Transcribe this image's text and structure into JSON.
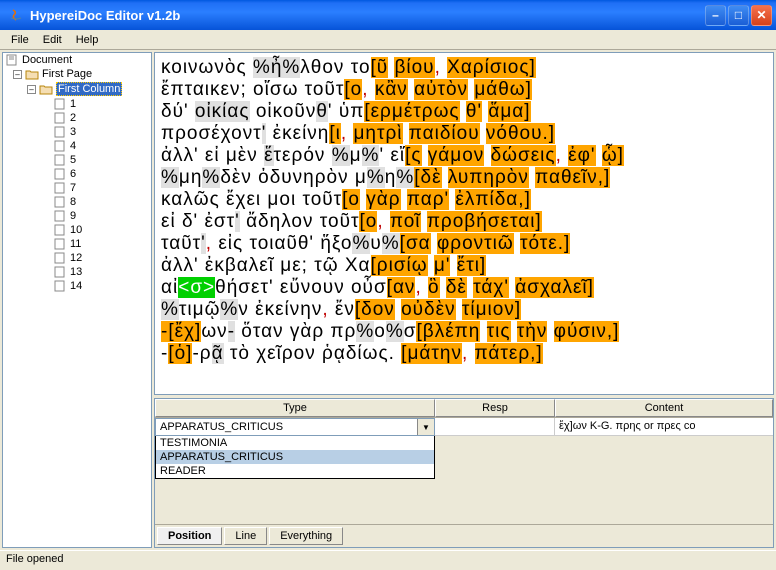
{
  "window": {
    "title": "HypereiDoc Editor v1.2b"
  },
  "menu": {
    "file": "File",
    "edit": "Edit",
    "help": "Help"
  },
  "tree": {
    "root": "Document",
    "page": "First Page",
    "column": "First Column",
    "lines": [
      "1",
      "2",
      "3",
      "4",
      "5",
      "6",
      "7",
      "8",
      "9",
      "10",
      "11",
      "12",
      "13",
      "14"
    ]
  },
  "text_lines": [
    [
      {
        "t": "κοινωνὸς "
      },
      {
        "t": "%",
        "c": "g"
      },
      {
        "t": "ἦ",
        "c": "g"
      },
      {
        "t": "%",
        "c": "g"
      },
      {
        "t": "λθον το"
      },
      {
        "t": "[ῦ",
        "c": "y"
      },
      {
        "t": " "
      },
      {
        "t": "βίου",
        "c": "y"
      },
      {
        "t": ",",
        "c": "red"
      },
      {
        "t": " "
      },
      {
        "t": "Χαρίσιος]",
        "c": "y"
      }
    ],
    [
      {
        "t": "ἔπταικεν; οἴσω τοῦτ"
      },
      {
        "t": "[ο",
        "c": "y"
      },
      {
        "t": ",",
        "c": "red"
      },
      {
        "t": " "
      },
      {
        "t": "κἂν",
        "c": "y"
      },
      {
        "t": " "
      },
      {
        "t": "αὐτὸν",
        "c": "y"
      },
      {
        "t": " "
      },
      {
        "t": "μάθω]",
        "c": "y"
      }
    ],
    [
      {
        "t": "δύ' "
      },
      {
        "t": "οἰκίας",
        "c": "g"
      },
      {
        "t": " "
      },
      {
        "t": "οἰκοῦν"
      },
      {
        "t": "θ",
        "c": "g"
      },
      {
        "t": "' ὑπ"
      },
      {
        "t": "[ερμέτρως",
        "c": "y"
      },
      {
        "t": " "
      },
      {
        "t": "θ'",
        "c": "y"
      },
      {
        "t": " "
      },
      {
        "t": "ἅμα]",
        "c": "y"
      }
    ],
    [
      {
        "t": "προσέχοντ"
      },
      {
        "t": "'",
        "c": "g"
      },
      {
        "t": " ἐκείνη"
      },
      {
        "t": "[ι",
        "c": "y"
      },
      {
        "t": ",",
        "c": "red"
      },
      {
        "t": " "
      },
      {
        "t": "μητρὶ",
        "c": "y"
      },
      {
        "t": " "
      },
      {
        "t": "παιδίου",
        "c": "y"
      },
      {
        "t": " "
      },
      {
        "t": "νόθου.]",
        "c": "y"
      }
    ],
    [
      {
        "t": "ἀλλ' εἰ μὲν "
      },
      {
        "t": "ἕ",
        "c": "g"
      },
      {
        "t": "τερόν "
      },
      {
        "t": "%",
        "c": "g"
      },
      {
        "t": "μ"
      },
      {
        "t": "%",
        "c": "g"
      },
      {
        "t": "' εἴ"
      },
      {
        "t": "[ς",
        "c": "y"
      },
      {
        "t": " "
      },
      {
        "t": "γάμον",
        "c": "y"
      },
      {
        "t": " "
      },
      {
        "t": "δώσεις",
        "c": "y"
      },
      {
        "t": ",",
        "c": "red"
      },
      {
        "t": " "
      },
      {
        "t": "ἐφ'",
        "c": "y"
      },
      {
        "t": " "
      },
      {
        "t": "ᾧ]",
        "c": "y"
      }
    ],
    [
      {
        "t": "%",
        "c": "g"
      },
      {
        "t": "μη"
      },
      {
        "t": "%",
        "c": "g"
      },
      {
        "t": "δὲν ὀδυνηρὸν μ"
      },
      {
        "t": "%",
        "c": "g"
      },
      {
        "t": "η"
      },
      {
        "t": "%",
        "c": "g"
      },
      {
        "t": "[δὲ",
        "c": "y"
      },
      {
        "t": " "
      },
      {
        "t": "λυπηρὸν",
        "c": "y"
      },
      {
        "t": " "
      },
      {
        "t": "παθεῖν",
        "c": "y"
      },
      {
        "t": ",]",
        "c": "y"
      }
    ],
    [
      {
        "t": "καλῶς ἔχει μοι "
      },
      {
        "t": " ",
        "c": "g"
      },
      {
        "t": "τοῦτ"
      },
      {
        "t": "[ο",
        "c": "y"
      },
      {
        "t": " "
      },
      {
        "t": "γὰρ",
        "c": "y"
      },
      {
        "t": " "
      },
      {
        "t": "παρ'",
        "c": "y"
      },
      {
        "t": " "
      },
      {
        "t": "ἐλπίδα",
        "c": "y"
      },
      {
        "t": ",]",
        "c": "y"
      }
    ],
    [
      {
        "t": "εἰ δ' ἐστ"
      },
      {
        "t": "'",
        "c": "g"
      },
      {
        "t": " ἄδηλον τοῦτ"
      },
      {
        "t": "[ο",
        "c": "y"
      },
      {
        "t": ",",
        "c": "red"
      },
      {
        "t": " "
      },
      {
        "t": "ποῖ",
        "c": "y"
      },
      {
        "t": " "
      },
      {
        "t": "προβήσεται]",
        "c": "y"
      }
    ],
    [
      {
        "t": "ταῦτ"
      },
      {
        "t": "'",
        "c": "g"
      },
      {
        "t": ",",
        "c": "red"
      },
      {
        "t": " εἰς τοιαῦθ' ἥξο"
      },
      {
        "t": "%",
        "c": "g"
      },
      {
        "t": "υ"
      },
      {
        "t": "%",
        "c": "g"
      },
      {
        "t": "[σα",
        "c": "y"
      },
      {
        "t": " "
      },
      {
        "t": "φροντιῶ",
        "c": "y"
      },
      {
        "t": " "
      },
      {
        "t": "τότε",
        "c": "y"
      },
      {
        "t": ".]",
        "c": "y"
      }
    ],
    [
      {
        "t": "ἀλλ' ἐκβαλεῖ με; τῷ Χα"
      },
      {
        "t": "[ρισίῳ",
        "c": "y"
      },
      {
        "t": " "
      },
      {
        "t": "μ'",
        "c": "y"
      },
      {
        "t": " "
      },
      {
        "t": "ἔτι]",
        "c": "y"
      }
    ],
    [
      {
        "t": "αἰ"
      },
      {
        "t": "<σ>",
        "c": "grn"
      },
      {
        "t": "θήσετ' εὔνουν οὖσ"
      },
      {
        "t": "[αν",
        "c": "y"
      },
      {
        "t": ",",
        "c": "red"
      },
      {
        "t": " "
      },
      {
        "t": "ὃ",
        "c": "y"
      },
      {
        "t": " "
      },
      {
        "t": "δὲ",
        "c": "y"
      },
      {
        "t": " "
      },
      {
        "t": "τάχ'",
        "c": "y"
      },
      {
        "t": " "
      },
      {
        "t": "ἀσχαλεῖ]",
        "c": "y"
      }
    ],
    [
      {
        "t": "%",
        "c": "g"
      },
      {
        "t": "τιμῷ"
      },
      {
        "t": "%",
        "c": "g"
      },
      {
        "t": "ν ἐκείνην"
      },
      {
        "t": ",",
        "c": "red"
      },
      {
        "t": " ἔν"
      },
      {
        "t": "[δον",
        "c": "y"
      },
      {
        "t": " "
      },
      {
        "t": "οὐδὲν",
        "c": "y"
      },
      {
        "t": " "
      },
      {
        "t": "τίμιον]",
        "c": "y"
      }
    ],
    [
      {
        "t": "-",
        "c": "y"
      },
      {
        "t": "[ἔχ]",
        "c": "y"
      },
      {
        "t": "ων"
      },
      {
        "t": "-",
        "c": "g"
      },
      {
        "t": "  ὅταν γὰρ πρ"
      },
      {
        "t": "%",
        "c": "g"
      },
      {
        "t": "ο"
      },
      {
        "t": "%",
        "c": "g"
      },
      {
        "t": "σ"
      },
      {
        "t": "[βλέπη",
        "c": "y"
      },
      {
        "t": " "
      },
      {
        "t": "τις",
        "c": "y"
      },
      {
        "t": " "
      },
      {
        "t": "τὴν",
        "c": "y"
      },
      {
        "t": " "
      },
      {
        "t": "φύσιν",
        "c": "y"
      },
      {
        "t": ",]",
        "c": "y"
      }
    ],
    [
      {
        "t": "-"
      },
      {
        "t": "[ὁ]",
        "c": "y"
      },
      {
        "t": "-ρ"
      },
      {
        "t": "ᾷ",
        "c": "g"
      },
      {
        "t": " τὸ χεῖρον ῥᾳδίως. "
      },
      {
        "t": "[μάτην",
        "c": "y"
      },
      {
        "t": ",",
        "c": "red"
      },
      {
        "t": " "
      },
      {
        "t": "πάτερ",
        "c": "y"
      },
      {
        "t": ",]",
        "c": "y"
      }
    ]
  ],
  "table": {
    "headers": {
      "type": "Type",
      "resp": "Resp",
      "content": "Content"
    },
    "selected": "APPARATUS_CRITICUS",
    "options": [
      "TESTIMONIA",
      "APPARATUS_CRITICUS",
      "READER"
    ],
    "content_value": "ἔχ]ων K-G. πρης or πρες co"
  },
  "tabs": {
    "position": "Position",
    "line": "Line",
    "everything": "Everything"
  },
  "status": "File opened"
}
